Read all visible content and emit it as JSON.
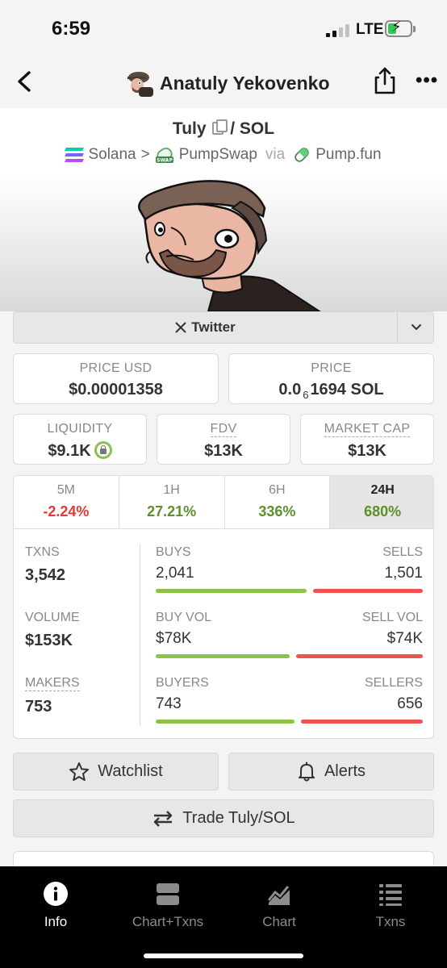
{
  "status": {
    "time": "6:59",
    "network": "LTE",
    "battery_pct": 40
  },
  "nav": {
    "title": "Anatuly Yekovenko"
  },
  "pair": {
    "base": "Tuly",
    "quote": "/ SOL",
    "chain": "Solana",
    "separator": ">",
    "dex": "PumpSwap",
    "via": "via",
    "launchpad": "Pump.fun"
  },
  "links": {
    "twitter_label": "Twitter"
  },
  "stats": {
    "price_usd_label": "PRICE USD",
    "price_usd": "$0.00001358",
    "price_label": "PRICE",
    "price_prefix": "0.0",
    "price_zeros": "6",
    "price_suffix": "1694 SOL",
    "liquidity_label": "LIQUIDITY",
    "liquidity": "$9.1K",
    "fdv_label": "FDV",
    "fdv": "$13K",
    "mcap_label": "MARKET CAP",
    "mcap": "$13K"
  },
  "timeframes": [
    {
      "label": "5M",
      "change": "-2.24%"
    },
    {
      "label": "1H",
      "change": "27.21%"
    },
    {
      "label": "6H",
      "change": "336%"
    },
    {
      "label": "24H",
      "change": "680%"
    }
  ],
  "metrics": {
    "txns_label": "TXNS",
    "txns": "3,542",
    "buys_label": "BUYS",
    "buys": "2,041",
    "sells_label": "SELLS",
    "sells": "1,501",
    "buys_share": 0.576,
    "volume_label": "VOLUME",
    "volume": "$153K",
    "buy_vol_label": "BUY VOL",
    "buy_vol": "$78K",
    "sell_vol_label": "SELL VOL",
    "sell_vol": "$74K",
    "buy_vol_share": 0.513,
    "makers_label": "MAKERS",
    "makers": "753",
    "buyers_label": "BUYERS",
    "buyers": "743",
    "sellers_label": "SELLERS",
    "sellers": "656",
    "buyers_share": 0.531
  },
  "actions": {
    "watchlist": "Watchlist",
    "alerts": "Alerts",
    "trade": "Trade Tuly/SOL"
  },
  "tabbar": [
    {
      "label": "Info",
      "icon": "info-icon",
      "active": true
    },
    {
      "label": "Chart+Txns",
      "icon": "chart-txns-icon",
      "active": false
    },
    {
      "label": "Chart",
      "icon": "chart-icon",
      "active": false
    },
    {
      "label": "Txns",
      "icon": "list-icon",
      "active": false
    }
  ],
  "colors": {
    "positive": "#5d8f2b",
    "negative": "#e53935",
    "buy_bar": "#8bc34a",
    "sell_bar": "#ef5350"
  }
}
